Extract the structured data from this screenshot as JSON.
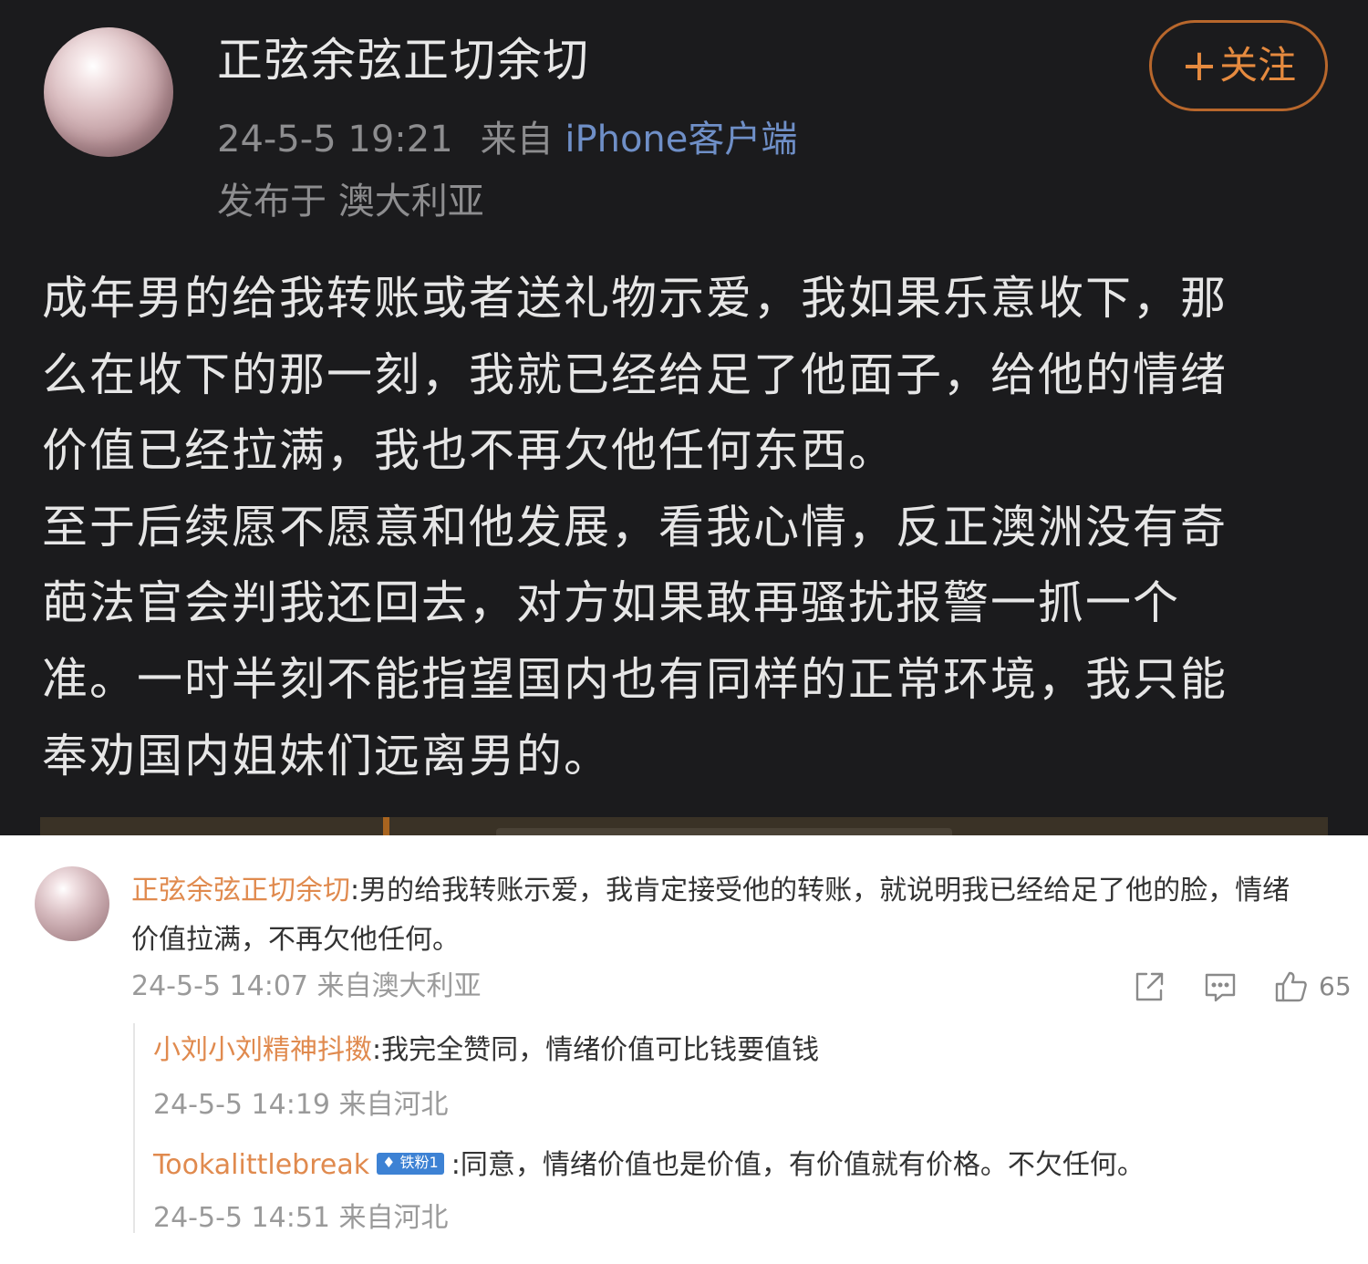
{
  "post": {
    "author": "正弦余弦正切余切",
    "follow_label": "关注",
    "follow_plus": "+",
    "datetime": "24-5-5 19:21",
    "from_label": "来自",
    "client": "iPhone客户端",
    "location": "发布于 澳大利亚",
    "body_lines": [
      "成年男的给我转账或者送礼物示爱，我如果乐意收下，那",
      "么在收下的那一刻，我就已经给足了他面子，给他的情绪",
      "价值已经拉满，我也不再欠他任何东西。",
      "至于后续愿不愿意和他发展，看我心情，反正澳洲没有奇",
      "葩法官会判我还回去，对方如果敢再骚扰报警一抓一个",
      "准。一时半刻不能指望国内也有同样的正常环境，我只能",
      "奉劝国内姐妹们远离男的。"
    ]
  },
  "comment": {
    "username": "正弦余弦正切余切",
    "separator": ":",
    "text_line1": "男的给我转账示爱，我肯定接受他的转账，就说明我已经给足了他的脸，情绪",
    "text_line2": "价值拉满，不再欠他任何。",
    "meta": "24-5-5 14:07 来自澳大利亚",
    "likes": "65",
    "replies": [
      {
        "username": "小刘小刘精神抖擞",
        "separator": ":",
        "text": "我完全赞同，情绪价值可比钱要值钱",
        "meta": "24-5-5 14:19 来自河北"
      },
      {
        "username": "Tookalittlebreak",
        "badge": "铁粉1",
        "separator": ":",
        "text": "同意，情绪价值也是价值，有价值就有价格。不欠任何。",
        "meta": "24-5-5 14:51 来自河北"
      }
    ]
  },
  "icons": {
    "share": "share-icon",
    "comment": "comment-icon",
    "like": "thumbs-up-icon"
  },
  "colors": {
    "dark_bg": "#1b1b1d",
    "follow_orange": "#e58a3f",
    "username_orange": "#e08a4e",
    "client_blue": "#6f8fc7",
    "badge_blue": "#3d82d4"
  }
}
